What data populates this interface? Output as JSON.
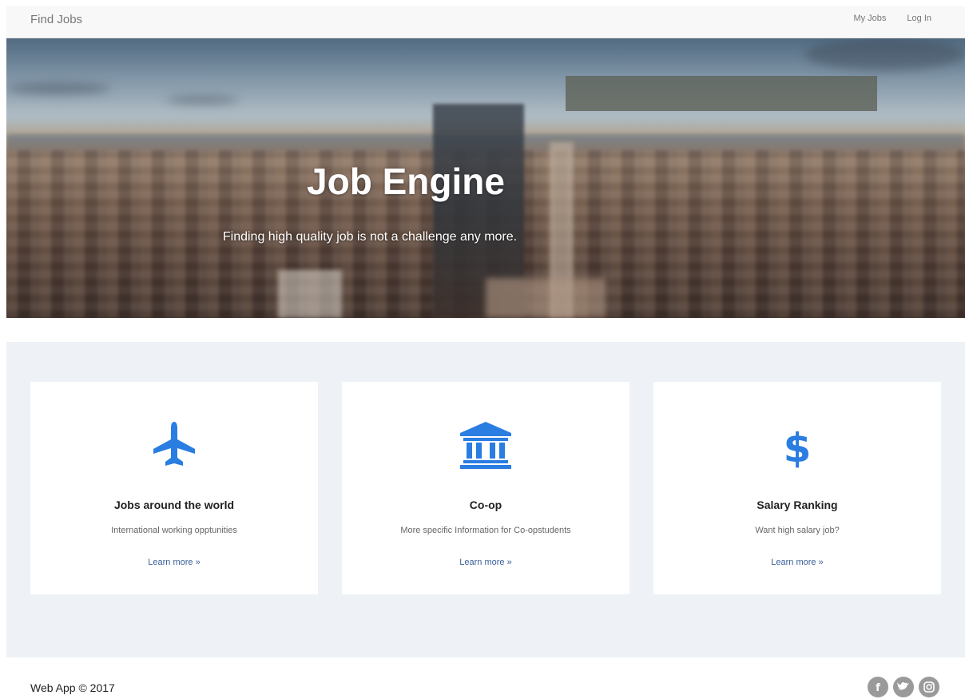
{
  "navbar": {
    "brand": "Find Jobs",
    "links": [
      "My Jobs",
      "Log In"
    ]
  },
  "hero": {
    "title": "Job Engine",
    "subtitle": "Finding high quality job is not a challenge any more."
  },
  "features": [
    {
      "icon": "airplane-icon",
      "title": "Jobs around the world",
      "text": "International working opptunities",
      "link": "Learn more »"
    },
    {
      "icon": "bank-icon",
      "title": "Co-op",
      "text": "More specific Information for Co-opstudents",
      "link": "Learn more »"
    },
    {
      "icon": "dollar-icon",
      "title": "Salary Ranking",
      "text": "Want high salary job?",
      "link": "Learn more »"
    }
  ],
  "footer": {
    "text": "Web App © 2017",
    "social": [
      "facebook-icon",
      "twitter-icon",
      "instagram-icon"
    ]
  },
  "colors": {
    "accent": "#2a7de1",
    "section_bg": "#eef2f6",
    "social_grey": "#9a9a9a"
  }
}
